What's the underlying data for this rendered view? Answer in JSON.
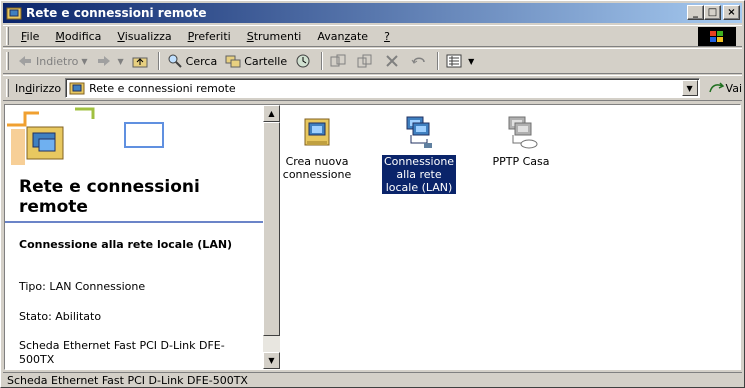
{
  "window": {
    "title": "Rete e connessioni remote",
    "minimize": "_",
    "maximize": "□",
    "close": "×"
  },
  "menu": {
    "items": [
      {
        "pre": "",
        "key": "F",
        "post": "ile"
      },
      {
        "pre": "",
        "key": "M",
        "post": "odifica"
      },
      {
        "pre": "",
        "key": "V",
        "post": "isualizza"
      },
      {
        "pre": "",
        "key": "P",
        "post": "referiti"
      },
      {
        "pre": "",
        "key": "S",
        "post": "trumenti"
      },
      {
        "pre": "Avan",
        "key": "z",
        "post": "ate"
      },
      {
        "pre": "",
        "key": "?",
        "post": ""
      }
    ]
  },
  "toolbar": {
    "back_label": "Indietro",
    "search_label": "Cerca",
    "folders_label": "Cartelle"
  },
  "address": {
    "label_pre": "In",
    "label_key": "d",
    "label_post": "irizzo",
    "value": "Rete e connessioni remote",
    "go_label": "Vai"
  },
  "leftpane": {
    "title": "Rete e connessioni remote",
    "connection_title": "Connessione alla rete locale (LAN)",
    "type": "Tipo: LAN Connessione",
    "status": "Stato: Abilitato",
    "adapter": "Scheda Ethernet Fast PCI D-Link DFE-500TX"
  },
  "items": [
    {
      "label": "Crea nuova connessione",
      "icon": "new-connection-icon",
      "selected": false
    },
    {
      "label": "Connessione alla rete locale (LAN)",
      "icon": "lan-connection-icon",
      "selected": true
    },
    {
      "label": "PPTP Casa",
      "icon": "vpn-connection-icon",
      "selected": false
    }
  ],
  "status": {
    "text": "Scheda Ethernet Fast PCI D-Link DFE-500TX"
  },
  "colors": {
    "title_start": "#0a246a",
    "title_end": "#a6caf0",
    "selection": "#0a246a",
    "face": "#d4d0c8"
  }
}
